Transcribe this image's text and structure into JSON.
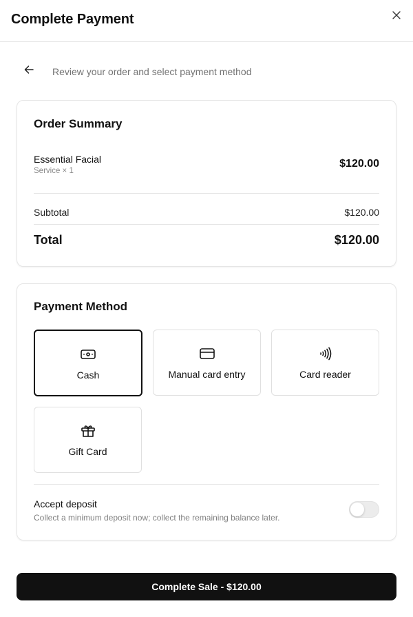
{
  "header": {
    "title": "Complete Payment",
    "close_icon": "close-icon"
  },
  "subheader": {
    "back_icon": "arrow-left-icon",
    "text": "Review your order and select payment method"
  },
  "order_summary": {
    "title": "Order Summary",
    "item": {
      "name": "Essential Facial",
      "detail": "Service × 1",
      "price": "$120.00"
    },
    "subtotal_label": "Subtotal",
    "subtotal_value": "$120.00",
    "total_label": "Total",
    "total_value": "$120.00"
  },
  "payment_method": {
    "title": "Payment Method",
    "options": [
      {
        "label": "Cash",
        "icon": "cash-icon",
        "selected": true
      },
      {
        "label": "Manual card entry",
        "icon": "credit-card-icon",
        "selected": false
      },
      {
        "label": "Card reader",
        "icon": "contactless-icon",
        "selected": false
      },
      {
        "label": "Gift Card",
        "icon": "gift-icon",
        "selected": false
      }
    ],
    "deposit": {
      "title": "Accept deposit",
      "description": "Collect a minimum deposit now; collect the remaining balance later.",
      "enabled": false
    }
  },
  "cta": {
    "label": "Complete Sale - $120.00"
  },
  "colors": {
    "primary": "#111111",
    "border": "#e5e5e5",
    "muted_text": "#737373"
  }
}
